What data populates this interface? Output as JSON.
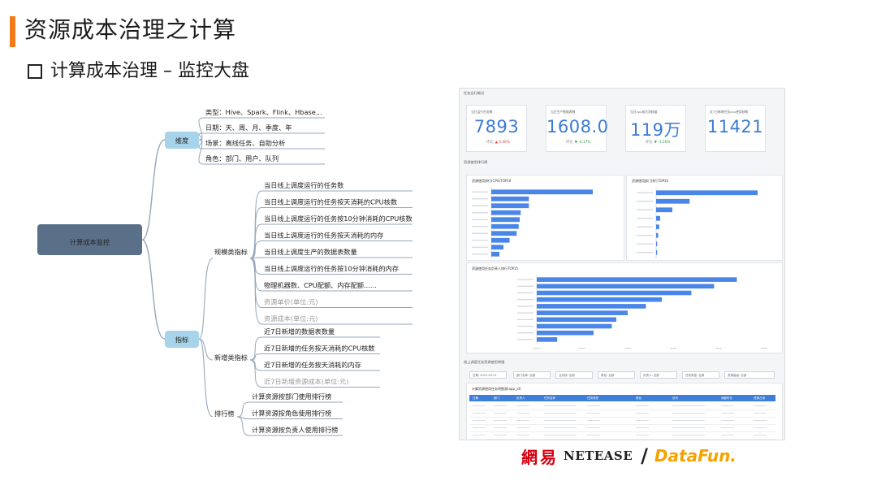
{
  "header": {
    "title": "资源成本治理之计算",
    "subtitle": "计算成本治理 – 监控大盘"
  },
  "mindmap": {
    "root": "计算成本监控",
    "dimension": {
      "label": "维度",
      "items": [
        "类型：Hive、Spark、Flink、Hbase...",
        "日期：天、周、月、季度、年",
        "场景：离线任务、自助分析",
        "角色：部门、用户、队列"
      ]
    },
    "metrics": {
      "label": "指标",
      "scale": {
        "label": "规模类指标",
        "items": [
          "当日线上调度运行的任务数",
          "当日线上调度运行的任务按天消耗的CPU核数",
          "当日线上调度运行的任务按10分钟消耗的CPU核数",
          "当日线上调度运行的任务按天消耗的内存",
          "当日线上调度生产的数据表数量",
          "当日线上调度运行的任务按10分钟消耗的内存",
          "物理机器数、CPU配额、内存配额......",
          "资源单价(单位:元)",
          "资源成本(单位:元)"
        ]
      },
      "growth": {
        "label": "新增类指标",
        "items": [
          "近7日新增的数据表数量",
          "近7日新增的任务按天消耗的CPU核数",
          "近7日新增的任务按天消耗的内存",
          "近7日新增资源成本(单位:元)"
        ]
      },
      "ranking": {
        "label": "排行榜",
        "items": [
          "计算资源按部门使用排行榜",
          "计算资源按角色使用排行榜",
          "计算资源按负责人使用排行榜"
        ]
      }
    }
  },
  "dashboard": {
    "section_overview": "任务运行概况",
    "kpis": [
      {
        "label": "当日运行任务数",
        "value": "7893",
        "compare": "环比",
        "change": "0.46%",
        "dir": "up"
      },
      {
        "label": "当日生产数据表数",
        "value": "1608.0",
        "compare": "环比",
        "change": "-0.37%",
        "dir": "down"
      },
      {
        "label": "当日cpu核天消耗量",
        "value": "119万",
        "compare": "环比",
        "change": "-1.26%",
        "dir": "down"
      },
      {
        "label": "近7日新增任务cpu使用核数",
        "value": "11421",
        "compare": "",
        "change": "",
        "dir": ""
      }
    ],
    "section_ranking": "资源使用排行榜",
    "section_detail": "线上调度任务资源使用明细",
    "filters": [
      "日期: 2021-03-11",
      "部门名称: 全部",
      "业务线: 全部",
      "角色: 全部",
      "负责人: 全部",
      "任务类型: 全部",
      "资源量级: 全部"
    ],
    "table_title": "计算资源使用任务明细表(app_id)",
    "table_columns": [
      "日期",
      "部门",
      "负责人",
      "任务名称",
      "任务类型",
      "角色",
      "队列",
      "调度时长",
      "资源占用"
    ]
  },
  "chart_data": [
    {
      "type": "bar",
      "title": "资源使用排行(CPU)TOP10",
      "values": [
        100,
        37,
        37,
        29,
        28,
        27,
        25,
        18,
        12,
        8
      ],
      "ylim": [
        0,
        120
      ]
    },
    {
      "type": "bar",
      "title": "资源使用部门排行TOP10",
      "values": [
        100,
        33,
        16,
        4,
        3,
        2,
        1,
        1
      ],
      "ylim": [
        0,
        120
      ]
    },
    {
      "type": "bar",
      "title": "资源使用任务负责人排行TOP15",
      "values": [
        88,
        78,
        68,
        55,
        48,
        40,
        35,
        33,
        25,
        9
      ],
      "ylim": [
        0,
        100
      ]
    }
  ],
  "footer": {
    "logo_netease_cn": "網易",
    "logo_netease_en": "NETEASE",
    "logo_separator": "/",
    "logo_datafun": "DataFun."
  },
  "colors": {
    "accent": "#ef7b1b",
    "root_node": "#5a7089",
    "category_node": "#a7d4ea",
    "connector": "#94a7bb",
    "bar_blue": "#4a86e8",
    "kpi_blue": "#3a7bd5"
  }
}
